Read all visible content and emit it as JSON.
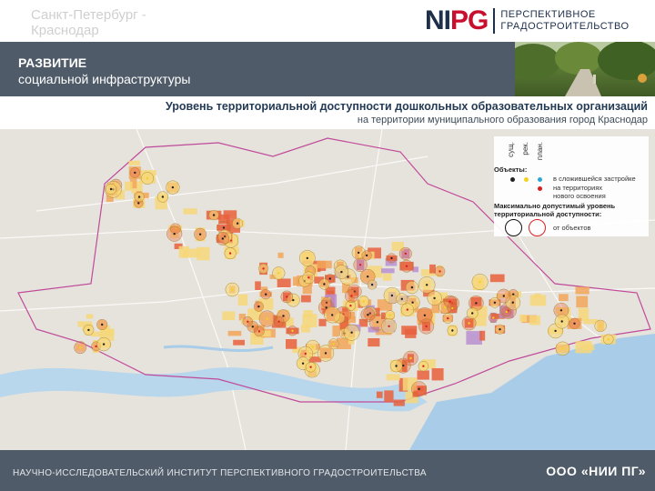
{
  "header": {
    "city": "Санкт-Петербург - Краснодар",
    "logo_mark_a": "NI",
    "logo_mark_b": "PG",
    "logo_line1": "ПЕРСПЕКТИВНОЕ",
    "logo_line2": "ГРАДОСТРОИТЕЛЬСТВО"
  },
  "band": {
    "title": "РАЗВИТИЕ",
    "subtitle": "социальной инфраструктуры"
  },
  "map": {
    "title": "Уровень территориальной доступности дошкольных образовательных организаций",
    "subtitle": "на территории муниципального образования город Краснодар"
  },
  "legend": {
    "col_existing": "сущ.",
    "col_reconstruction": "рек.",
    "col_planned": "план.",
    "objects_label": "Объекты:",
    "item_built": "в сложившейся застройке",
    "item_new_line1": "на территориях",
    "item_new_line2": "нового освоения",
    "access_line1": "Максимально допустимый уровень",
    "access_line2": "территориальной доступности:",
    "from_objects": "от объектов",
    "colors": {
      "existing": "#222222",
      "reconstruction": "#f2d21b",
      "planned_built": "#2aa7d8",
      "planned_new": "#d62020",
      "ring_existing": "#111111",
      "ring_planned": "#d62020"
    }
  },
  "colors": {
    "band": "#4f5b68",
    "zone_red": "#e8603c",
    "zone_orange": "#f2a65a",
    "zone_yellow": "#f6d77a",
    "zone_purple": "#b78fd0",
    "water": "#a9cde8",
    "boundary": "#c04a9a"
  },
  "footer": {
    "institute": "НАУЧНО-ИССЛЕДОВАТЕЛЬСКИЙ ИНСТИТУТ ПЕРСПЕКТИВНОГО ГРАДОСТРОИТЕЛЬСТВА",
    "company": "ООО «НИИ ПГ»"
  }
}
